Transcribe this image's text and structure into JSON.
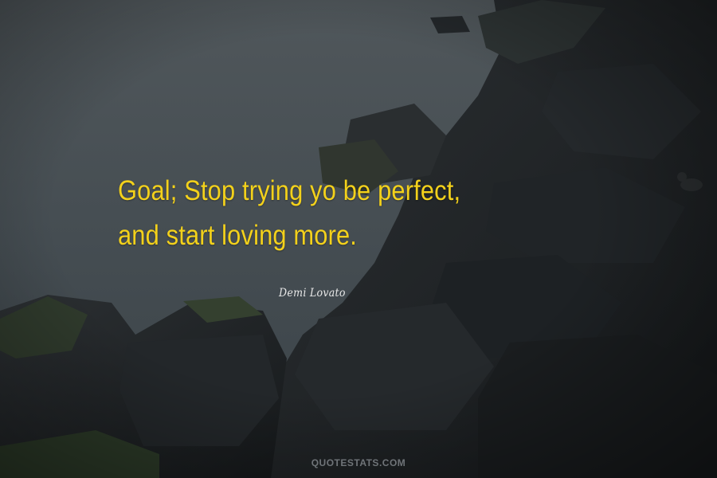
{
  "quote": {
    "line1": "Goal; Stop trying yo be perfect,",
    "line2": "and start loving more."
  },
  "author": "Demi Lovato",
  "watermark": "QUOTESTATS.COM",
  "colors": {
    "quote_text": "#f3d11b",
    "author_text": "#e8e8e8",
    "watermark_text": "#6f7478",
    "sea": "#4a5257",
    "rocks": "#1f2326"
  }
}
